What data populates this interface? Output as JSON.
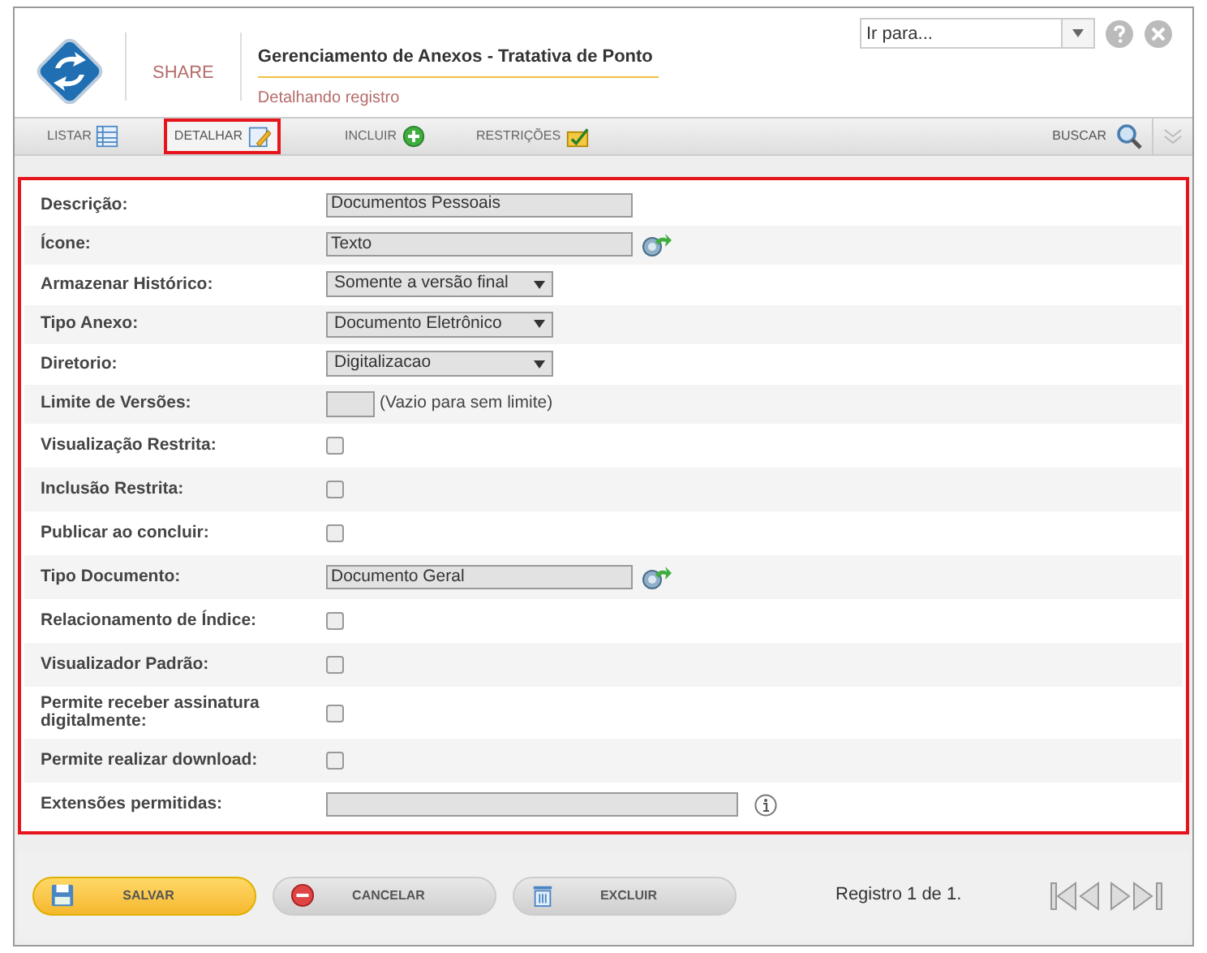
{
  "header": {
    "brand": "SHARE",
    "title": "Gerenciamento de Anexos - Tratativa de Ponto",
    "subtitle": "Detalhando registro",
    "goto": {
      "placeholder": "Ir para..."
    }
  },
  "tabs": [
    {
      "label": "LISTAR",
      "selected": false
    },
    {
      "label": "DETALHAR",
      "selected": true
    },
    {
      "label": "INCLUIR",
      "selected": false
    },
    {
      "label": "RESTRIÇÕES",
      "selected": false
    }
  ],
  "search_label": "BUSCAR",
  "form": [
    {
      "kind": "text",
      "label": "Descrição:",
      "value": "Documentos Pessoais"
    },
    {
      "kind": "lookup",
      "label": "Ícone:",
      "value": "Texto"
    },
    {
      "kind": "select",
      "label": "Armazenar Histórico:",
      "value": "Somente a versão final"
    },
    {
      "kind": "select",
      "label": "Tipo Anexo:",
      "value": "Documento Eletrônico"
    },
    {
      "kind": "select",
      "label": "Diretorio:",
      "value": "Digitalizacao"
    },
    {
      "kind": "number",
      "label": "Limite de Versões:",
      "hint": "(Vazio para sem limite)"
    },
    {
      "kind": "checkbox",
      "label": "Visualização Restrita:",
      "checked": false
    },
    {
      "kind": "checkbox",
      "label": "Inclusão Restrita:",
      "checked": false
    },
    {
      "kind": "checkbox",
      "label": "Publicar ao concluir:",
      "checked": false
    },
    {
      "kind": "lookup",
      "label": "Tipo Documento:",
      "value": "Documento Geral"
    },
    {
      "kind": "checkbox",
      "label": "Relacionamento de Índice:",
      "checked": false
    },
    {
      "kind": "checkbox",
      "label": "Visualizador Padrão:",
      "checked": false
    },
    {
      "kind": "checkbox",
      "label": "Permite receber assinatura digitalmente:",
      "checked": false
    },
    {
      "kind": "checkbox",
      "label": "Permite realizar download:",
      "checked": false
    },
    {
      "kind": "extensions",
      "label": "Extensões permitidas:"
    }
  ],
  "buttons": [
    {
      "label": "SALVAR",
      "kind": "save"
    },
    {
      "label": "CANCELAR",
      "kind": "cancel"
    },
    {
      "label": "EXCLUIR",
      "kind": "delete"
    }
  ],
  "record_count": "Registro 1 de 1."
}
